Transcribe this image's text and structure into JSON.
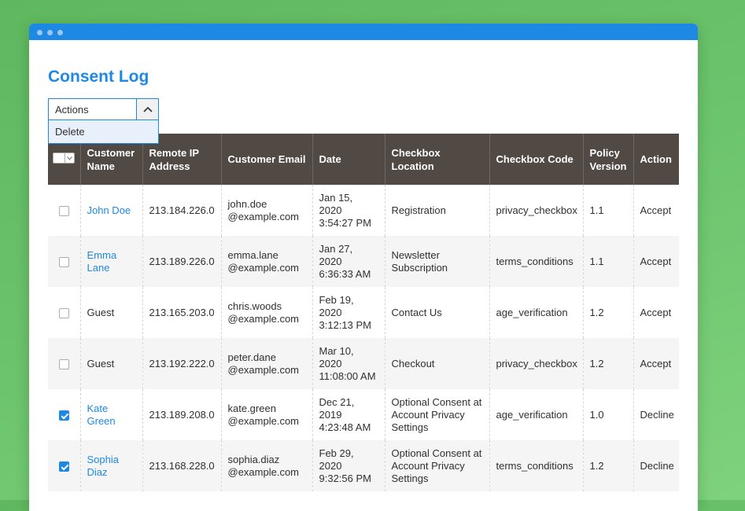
{
  "page": {
    "title": "Consent Log"
  },
  "actions": {
    "label": "Actions",
    "options": [
      "Delete"
    ]
  },
  "table": {
    "columns": [
      "Customer Name",
      "Remote IP Address",
      "Customer Email",
      "Date",
      "Checkbox Location",
      "Checkbox Code",
      "Policy Version",
      "Action"
    ],
    "rows": [
      {
        "checked": false,
        "name": "John Doe",
        "name_is_link": true,
        "ip": "213.184.226.0",
        "email_line1": "john.doe",
        "email_line2": "@example.com",
        "date_line1": "Jan 15, 2020",
        "date_line2": "3:54:27 PM",
        "location": "Registration",
        "code": "privacy_checkbox",
        "version": "1.1",
        "action": "Accept"
      },
      {
        "checked": false,
        "name": "Emma Lane",
        "name_is_link": true,
        "ip": "213.189.226.0",
        "email_line1": "emma.lane",
        "email_line2": "@example.com",
        "date_line1": "Jan 27, 2020",
        "date_line2": "6:36:33 AM",
        "location": "Newsletter Subscription",
        "code": "terms_conditions",
        "version": "1.1",
        "action": "Accept"
      },
      {
        "checked": false,
        "name": "Guest",
        "name_is_link": false,
        "ip": "213.165.203.0",
        "email_line1": "chris.woods",
        "email_line2": "@example.com",
        "date_line1": "Feb 19, 2020",
        "date_line2": "3:12:13 PM",
        "location": "Contact Us",
        "code": "age_verification",
        "version": "1.2",
        "action": "Accept"
      },
      {
        "checked": false,
        "name": "Guest",
        "name_is_link": false,
        "ip": "213.192.222.0",
        "email_line1": "peter.dane",
        "email_line2": "@example.com",
        "date_line1": "Mar 10, 2020",
        "date_line2": "11:08:00 AM",
        "location": "Checkout",
        "code": "privacy_checkbox",
        "version": "1.2",
        "action": "Accept"
      },
      {
        "checked": true,
        "name": "Kate Green",
        "name_is_link": true,
        "ip": "213.189.208.0",
        "email_line1": "kate.green",
        "email_line2": "@example.com",
        "date_line1": "Dec 21, 2019",
        "date_line2": "4:23:48 AM",
        "location": "Optional Consent at Account Privacy Settings",
        "code": "age_verification",
        "version": "1.0",
        "action": "Decline"
      },
      {
        "checked": true,
        "name": "Sophia Diaz",
        "name_is_link": true,
        "ip": "213.168.228.0",
        "email_line1": "sophia.diaz",
        "email_line2": "@example.com",
        "date_line1": "Feb 29, 2020",
        "date_line2": "9:32:56 PM",
        "location": "Optional Consent at Account Privacy Settings",
        "code": "terms_conditions",
        "version": "1.2",
        "action": "Decline"
      }
    ]
  },
  "colors": {
    "accent": "#1e88e5",
    "header_bg": "#514943",
    "titlebar": "#1e88e5",
    "background": "#5fb85f"
  }
}
